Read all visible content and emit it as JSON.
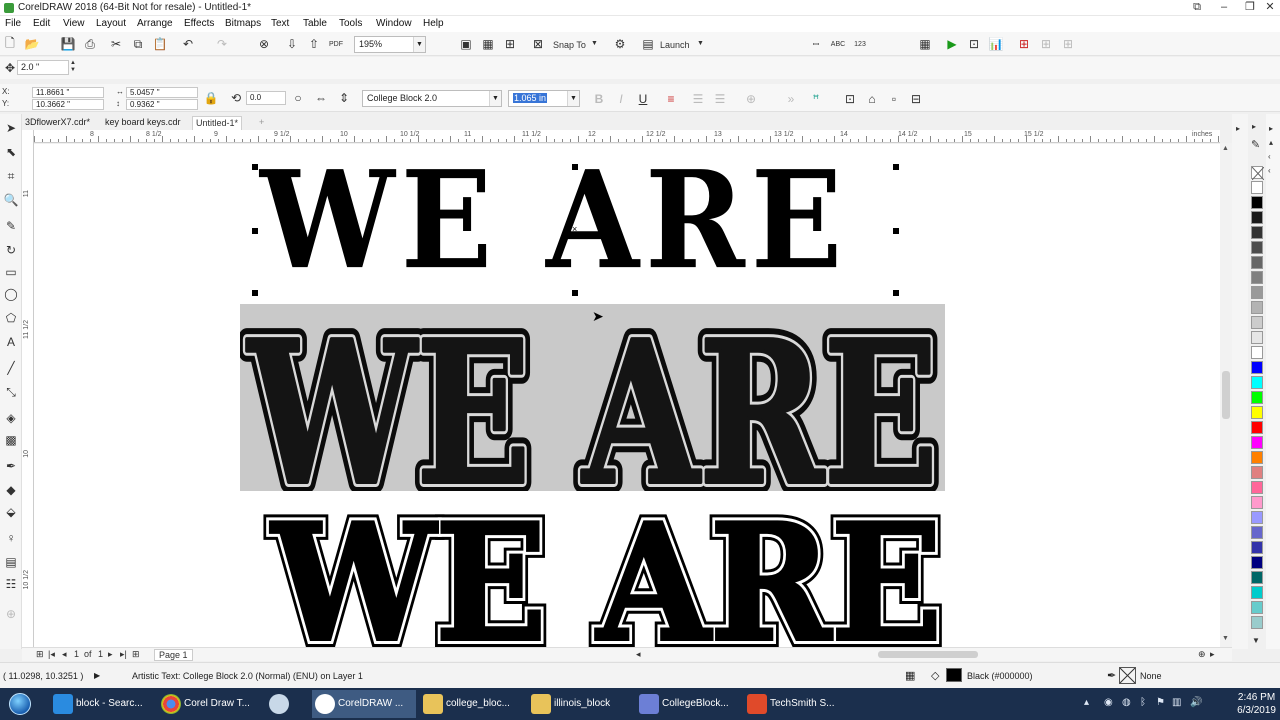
{
  "window": {
    "title": "CorelDRAW 2018 (64-Bit Not for resale) - Untitled-1*"
  },
  "menu": [
    "File",
    "Edit",
    "View",
    "Layout",
    "Arrange",
    "Effects",
    "Bitmaps",
    "Text",
    "Table",
    "Tools",
    "Window",
    "Help"
  ],
  "toolbar": {
    "zoom": "195%",
    "snap_to": "Snap To",
    "launch": "Launch"
  },
  "propbar1": {
    "nudge": "2.0 \""
  },
  "propbar2": {
    "x": "11.8661 \"",
    "y": "10.3662 \"",
    "width": "5.0457 \"",
    "height": "0.9362 \"",
    "rotation": "0.0",
    "font": "College Block 2.0",
    "font_size": "1.065 in",
    "x_label": "X:",
    "y_label": "Y:"
  },
  "doc_tabs": [
    "3DflowerX7.cdr*",
    "key board keys.cdr",
    "Untitled-1*"
  ],
  "ruler": {
    "h_labels": [
      "8",
      "8 1/2",
      "9",
      "9 1/2",
      "10",
      "10 1/2",
      "11",
      "11 1/2",
      "12",
      "12 1/2",
      "13",
      "13 1/2",
      "14",
      "14 1/2",
      "15",
      "15 1/2"
    ],
    "units": "inches",
    "v_labels": [
      "11",
      "11 1/2",
      "10",
      "10 1/2"
    ]
  },
  "canvas": {
    "text_top": "WE ARE",
    "text_bottom": "WE ARE",
    "photo_text": "WE ARE"
  },
  "page_nav": {
    "current": "1",
    "of": "of",
    "total": "1",
    "page_tab": "Page 1"
  },
  "status": {
    "coords": "( 11.0298, 10.3251 )",
    "object_info": "Artistic Text: College Block 2.0 (Normal) (ENU) on Layer 1",
    "fill": "Black (#000000)",
    "outline": "None"
  },
  "taskbar": {
    "items": [
      {
        "label": "block - Searc...",
        "kind": "ie"
      },
      {
        "label": "Corel Draw T...",
        "kind": "chrome"
      },
      {
        "label": "",
        "kind": "paint"
      },
      {
        "label": "CorelDRAW ...",
        "kind": "corel"
      },
      {
        "label": "college_bloc...",
        "kind": "folder"
      },
      {
        "label": "illinois_block",
        "kind": "folder"
      },
      {
        "label": "CollegeBlock...",
        "kind": "fontviewer"
      },
      {
        "label": "TechSmith S...",
        "kind": "techsmith"
      }
    ],
    "time": "2:46 PM",
    "date": "6/3/2019"
  },
  "palette_colors": [
    "#ffffff",
    "#000000",
    "#1a1a1a",
    "#333333",
    "#4d4d4d",
    "#666666",
    "#808080",
    "#999999",
    "#b3b3b3",
    "#cccccc",
    "#e6e6e6",
    "#ffffff",
    "#0000ff",
    "#00ffff",
    "#00ff00",
    "#ffff00",
    "#ff0000",
    "#ff00ff",
    "#ff8000",
    "#e08080",
    "#ff6699",
    "#ff99cc",
    "#9999ff",
    "#6666cc",
    "#3333aa",
    "#000080",
    "#006666",
    "#00cccc",
    "#66cccc",
    "#99cccc"
  ]
}
